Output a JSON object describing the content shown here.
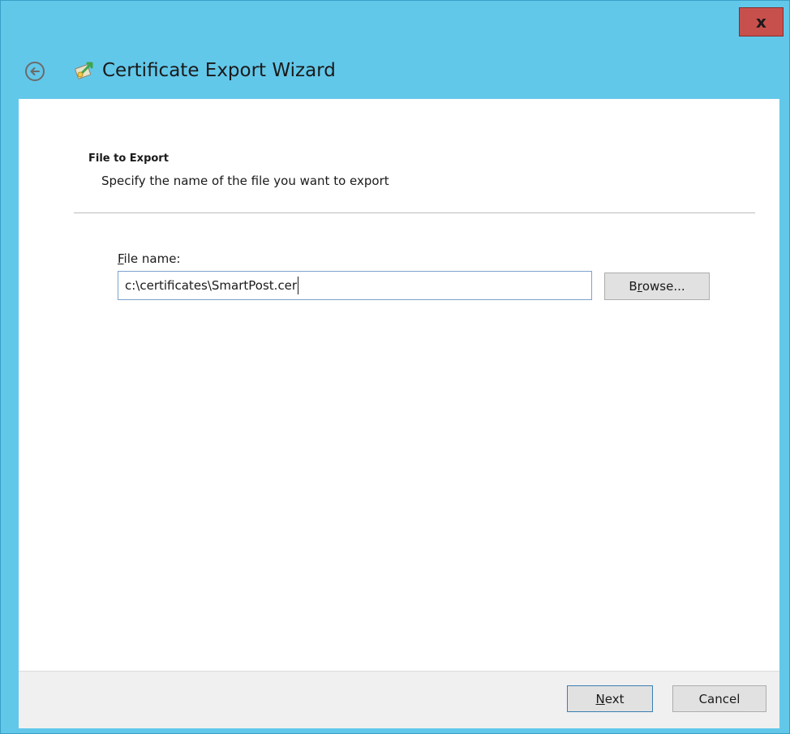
{
  "window": {
    "title": "Certificate Export Wizard",
    "close_label": "x",
    "accent_color": "#62c8ea",
    "close_color": "#c7504d"
  },
  "icons": {
    "back": "back-arrow-icon",
    "wizard": "certificate-wizard-icon"
  },
  "section": {
    "title": "File to Export",
    "subtitle": "Specify the name of the file you want to export"
  },
  "file": {
    "label_first": "F",
    "label_rest": "ile name:",
    "value": "c:\\certificates\\SmartPost.cer"
  },
  "buttons": {
    "browse_pre": "B",
    "browse_under": "r",
    "browse_post": "owse...",
    "next_under": "N",
    "next_rest": "ext",
    "cancel": "Cancel"
  }
}
